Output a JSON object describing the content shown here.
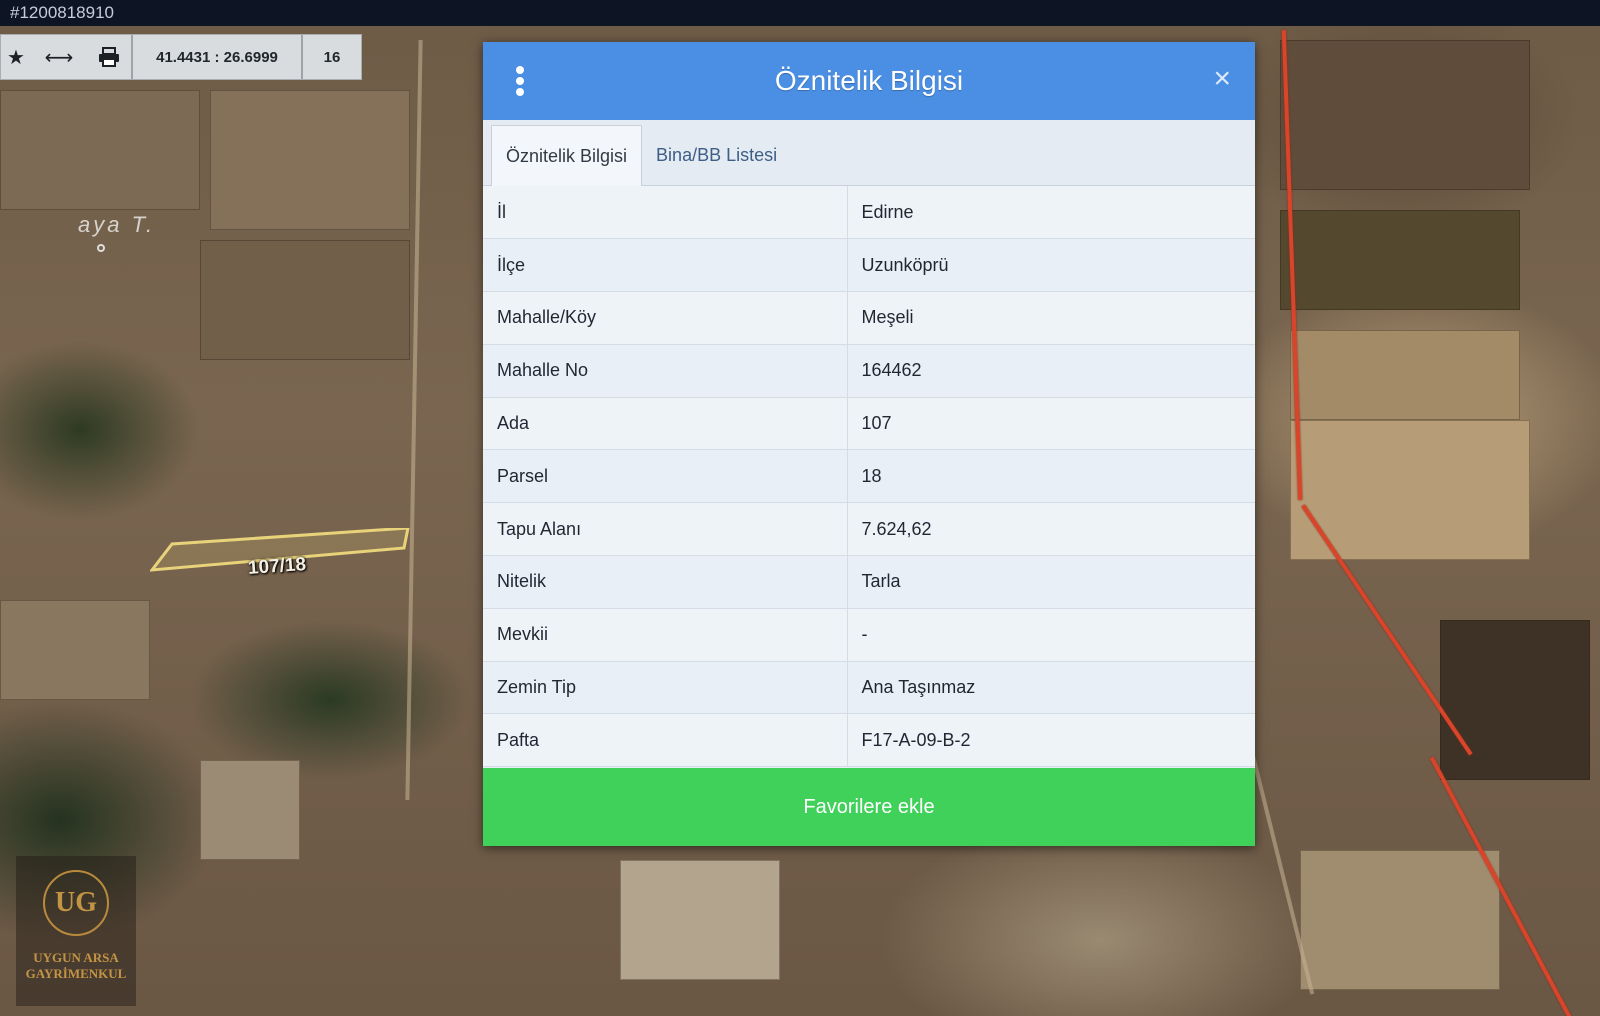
{
  "listing_id": "#1200818910",
  "map": {
    "coordinates": "41.4431 : 26.6999",
    "zoom_level": "16",
    "place_label": "aya T.",
    "parcel_label": "107/18"
  },
  "toolbar": {
    "icons": [
      "star-icon",
      "pan-arrows-icon",
      "print-icon"
    ]
  },
  "logo": {
    "monogram": "UG",
    "line1": "UYGUN ARSA",
    "line2": "GAYRİMENKUL"
  },
  "dialog": {
    "title": "Öznitelik Bilgisi",
    "close_symbol": "×",
    "tabs": [
      {
        "label": "Öznitelik Bilgisi",
        "active": true
      },
      {
        "label": "Bina/BB Listesi",
        "active": false
      }
    ],
    "rows": [
      {
        "key": "İl",
        "value": "Edirne"
      },
      {
        "key": "İlçe",
        "value": "Uzunköprü"
      },
      {
        "key": "Mahalle/Köy",
        "value": "Meşeli"
      },
      {
        "key": "Mahalle No",
        "value": "164462"
      },
      {
        "key": "Ada",
        "value": "107"
      },
      {
        "key": "Parsel",
        "value": "18"
      },
      {
        "key": "Tapu Alanı",
        "value": "7.624,62"
      },
      {
        "key": "Nitelik",
        "value": "Tarla"
      },
      {
        "key": "Mevkii",
        "value": "-"
      },
      {
        "key": "Zemin Tip",
        "value": "Ana Taşınmaz"
      },
      {
        "key": "Pafta",
        "value": "F17-A-09-B-2"
      }
    ],
    "favorite_button": "Favorilere ekle"
  },
  "colors": {
    "header": "#4a8fe3",
    "favorite_button": "#3fd15a",
    "parcel_outline": "#e8d27a"
  }
}
